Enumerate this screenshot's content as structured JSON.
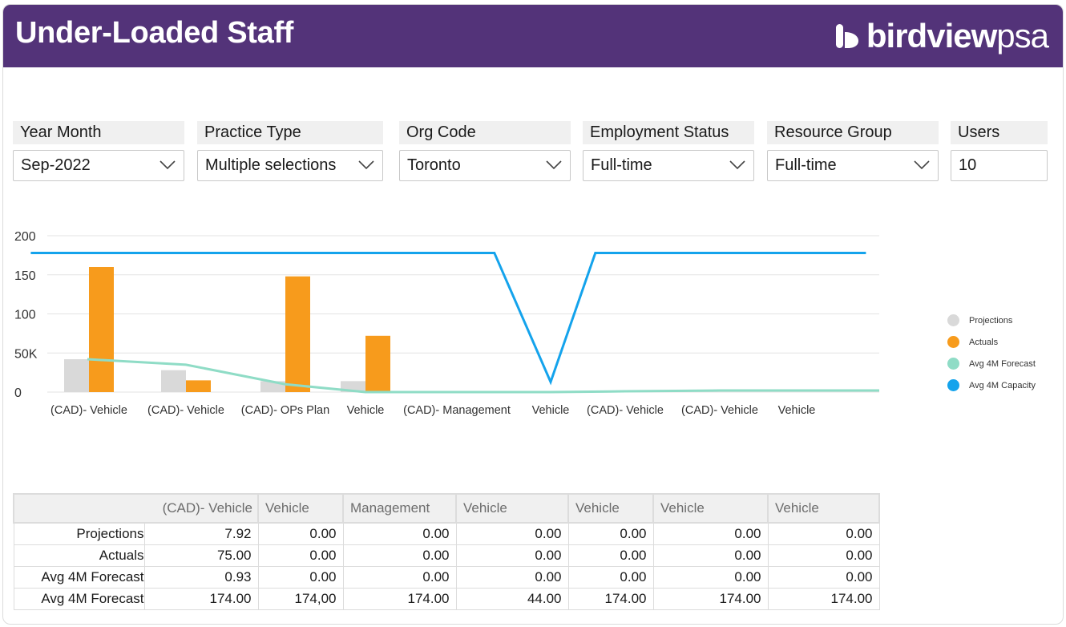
{
  "header": {
    "title": "Under-Loaded Staff",
    "logo_bold": "birdview",
    "logo_light": "psa"
  },
  "filters": [
    {
      "label": "Year Month",
      "value": "Sep-2022",
      "type": "dropdown"
    },
    {
      "label": "Practice Type",
      "value": "Multiple selections",
      "type": "dropdown"
    },
    {
      "label": "Org Code",
      "value": "Toronto",
      "type": "dropdown"
    },
    {
      "label": "Employment Status",
      "value": "Full-time",
      "type": "dropdown"
    },
    {
      "label": "Resource Group",
      "value": "Full-time",
      "type": "dropdown"
    },
    {
      "label": "Users",
      "value": "10",
      "type": "input"
    }
  ],
  "chart_data": {
    "type": "bar",
    "categories": [
      "(CAD)- Vehicle",
      "(CAD)- Vehicle",
      "(CAD)- OPs Plan",
      "Vehicle",
      "(CAD)- Management",
      "Vehicle",
      "(CAD)- Vehicle",
      "(CAD)- Vehicle",
      "Vehicle"
    ],
    "y_tick_labels": [
      "0",
      "50K",
      "100",
      "150",
      "200"
    ],
    "ylim": [
      0,
      200
    ],
    "grid": true,
    "legend_position": "right",
    "series": [
      {
        "name": "Projections",
        "kind": "bar",
        "color": "#d9d9d9",
        "values": [
          42,
          28,
          14,
          14,
          0,
          0,
          0,
          0,
          0
        ]
      },
      {
        "name": "Actuals",
        "kind": "bar",
        "color": "#f79b1c",
        "values": [
          160,
          15,
          148,
          72,
          0,
          0,
          0,
          0,
          0
        ]
      },
      {
        "name": "Avg 4M Forecast",
        "kind": "line",
        "color": "#8fdcc6",
        "values": [
          42,
          35,
          10,
          0,
          0,
          0,
          1,
          2,
          2
        ]
      },
      {
        "name": "Avg 4M Capacity",
        "kind": "line",
        "color": "#14a3ec",
        "points": [
          [
            -0.6,
            178
          ],
          [
            4.4,
            178
          ],
          [
            5.0,
            13
          ],
          [
            5.6,
            178
          ],
          [
            8.9,
            178
          ]
        ]
      }
    ]
  },
  "table": {
    "columns": [
      "(CAD)- Vehicle",
      "Vehicle",
      "Management",
      "Vehicle",
      "Vehicle",
      "Vehicle",
      "Vehicle"
    ],
    "rows": [
      {
        "label": "Projections",
        "values": [
          "7.92",
          "0.00",
          "0.00",
          "0.00",
          "0.00",
          "0.00",
          "0.00"
        ]
      },
      {
        "label": "Actuals",
        "values": [
          "75.00",
          "0.00",
          "0.00",
          "0.00",
          "0.00",
          "0.00",
          "0.00"
        ]
      },
      {
        "label": "Avg 4M Forecast",
        "values": [
          "0.93",
          "0.00",
          "0.00",
          "0.00",
          "0.00",
          "0.00",
          "0.00"
        ]
      },
      {
        "label": "Avg 4M Forecast",
        "values": [
          "174.00",
          "174,00",
          "174.00",
          "44.00",
          "174.00",
          "174.00",
          "174.00"
        ]
      }
    ]
  }
}
